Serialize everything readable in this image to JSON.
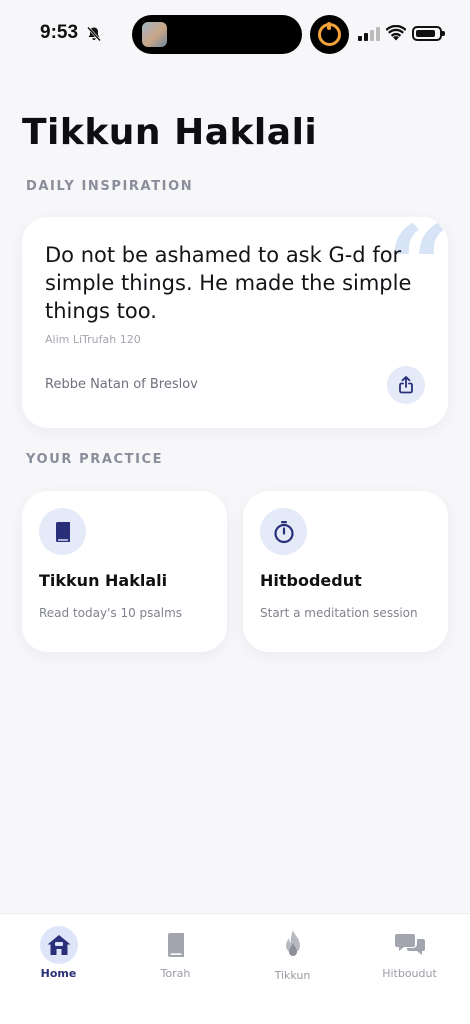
{
  "status_bar": {
    "time": "9:53"
  },
  "page": {
    "title": "Tikkun Haklali"
  },
  "daily_inspiration": {
    "label": "DAILY INSPIRATION",
    "quote": "Do not be ashamed to ask G-d for simple things. He made the simple things too.",
    "source": "Alim LiTrufah 120",
    "author": "Rebbe Natan of Breslov"
  },
  "practice": {
    "label": "YOUR PRACTICE",
    "cards": [
      {
        "title": "Tikkun Haklali",
        "subtitle": "Read today's 10 psalms",
        "icon": "book-icon"
      },
      {
        "title": "Hitbodedut",
        "subtitle": "Start a meditation session",
        "icon": "stopwatch-icon"
      }
    ]
  },
  "tabbar": {
    "tabs": [
      {
        "label": "Home",
        "icon": "home-icon",
        "active": true
      },
      {
        "label": "Torah",
        "icon": "book-icon",
        "active": false
      },
      {
        "label": "Tikkun",
        "icon": "flame-icon",
        "active": false
      },
      {
        "label": "Hitboudut",
        "icon": "chat-bubbles-icon",
        "active": false
      }
    ]
  },
  "colors": {
    "accent": "#2a2f7a",
    "icon_bg": "#e4eaf8",
    "quote_mark": "#d6e4f6",
    "background": "#f7f7fa"
  }
}
